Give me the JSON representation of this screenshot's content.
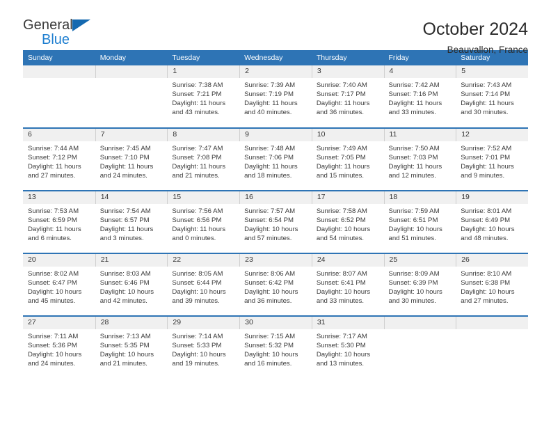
{
  "brand": {
    "name_part1": "General",
    "name_part2": "Blue",
    "accent_color": "#1f7fd0",
    "triangle_color": "#1569b0",
    "triangle_icon": "triangle-icon"
  },
  "header": {
    "title": "October 2024",
    "subtitle": "Beauvallon, France"
  },
  "theme": {
    "header_blue": "#2e74b5",
    "daynum_band": "#f0f0f0",
    "text": "#3a3a3a"
  },
  "weekdays": [
    "Sunday",
    "Monday",
    "Tuesday",
    "Wednesday",
    "Thursday",
    "Friday",
    "Saturday"
  ],
  "labels": {
    "sunrise_prefix": "Sunrise:",
    "sunset_prefix": "Sunset:",
    "daylight_prefix": "Daylight:"
  },
  "weeks": [
    [
      {
        "day": "",
        "empty": true
      },
      {
        "day": "",
        "empty": true
      },
      {
        "day": "1",
        "sunrise": "Sunrise: 7:38 AM",
        "sunset": "Sunset: 7:21 PM",
        "daylight": "Daylight: 11 hours and 43 minutes."
      },
      {
        "day": "2",
        "sunrise": "Sunrise: 7:39 AM",
        "sunset": "Sunset: 7:19 PM",
        "daylight": "Daylight: 11 hours and 40 minutes."
      },
      {
        "day": "3",
        "sunrise": "Sunrise: 7:40 AM",
        "sunset": "Sunset: 7:17 PM",
        "daylight": "Daylight: 11 hours and 36 minutes."
      },
      {
        "day": "4",
        "sunrise": "Sunrise: 7:42 AM",
        "sunset": "Sunset: 7:16 PM",
        "daylight": "Daylight: 11 hours and 33 minutes."
      },
      {
        "day": "5",
        "sunrise": "Sunrise: 7:43 AM",
        "sunset": "Sunset: 7:14 PM",
        "daylight": "Daylight: 11 hours and 30 minutes."
      }
    ],
    [
      {
        "day": "6",
        "sunrise": "Sunrise: 7:44 AM",
        "sunset": "Sunset: 7:12 PM",
        "daylight": "Daylight: 11 hours and 27 minutes."
      },
      {
        "day": "7",
        "sunrise": "Sunrise: 7:45 AM",
        "sunset": "Sunset: 7:10 PM",
        "daylight": "Daylight: 11 hours and 24 minutes."
      },
      {
        "day": "8",
        "sunrise": "Sunrise: 7:47 AM",
        "sunset": "Sunset: 7:08 PM",
        "daylight": "Daylight: 11 hours and 21 minutes."
      },
      {
        "day": "9",
        "sunrise": "Sunrise: 7:48 AM",
        "sunset": "Sunset: 7:06 PM",
        "daylight": "Daylight: 11 hours and 18 minutes."
      },
      {
        "day": "10",
        "sunrise": "Sunrise: 7:49 AM",
        "sunset": "Sunset: 7:05 PM",
        "daylight": "Daylight: 11 hours and 15 minutes."
      },
      {
        "day": "11",
        "sunrise": "Sunrise: 7:50 AM",
        "sunset": "Sunset: 7:03 PM",
        "daylight": "Daylight: 11 hours and 12 minutes."
      },
      {
        "day": "12",
        "sunrise": "Sunrise: 7:52 AM",
        "sunset": "Sunset: 7:01 PM",
        "daylight": "Daylight: 11 hours and 9 minutes."
      }
    ],
    [
      {
        "day": "13",
        "sunrise": "Sunrise: 7:53 AM",
        "sunset": "Sunset: 6:59 PM",
        "daylight": "Daylight: 11 hours and 6 minutes."
      },
      {
        "day": "14",
        "sunrise": "Sunrise: 7:54 AM",
        "sunset": "Sunset: 6:57 PM",
        "daylight": "Daylight: 11 hours and 3 minutes."
      },
      {
        "day": "15",
        "sunrise": "Sunrise: 7:56 AM",
        "sunset": "Sunset: 6:56 PM",
        "daylight": "Daylight: 11 hours and 0 minutes."
      },
      {
        "day": "16",
        "sunrise": "Sunrise: 7:57 AM",
        "sunset": "Sunset: 6:54 PM",
        "daylight": "Daylight: 10 hours and 57 minutes."
      },
      {
        "day": "17",
        "sunrise": "Sunrise: 7:58 AM",
        "sunset": "Sunset: 6:52 PM",
        "daylight": "Daylight: 10 hours and 54 minutes."
      },
      {
        "day": "18",
        "sunrise": "Sunrise: 7:59 AM",
        "sunset": "Sunset: 6:51 PM",
        "daylight": "Daylight: 10 hours and 51 minutes."
      },
      {
        "day": "19",
        "sunrise": "Sunrise: 8:01 AM",
        "sunset": "Sunset: 6:49 PM",
        "daylight": "Daylight: 10 hours and 48 minutes."
      }
    ],
    [
      {
        "day": "20",
        "sunrise": "Sunrise: 8:02 AM",
        "sunset": "Sunset: 6:47 PM",
        "daylight": "Daylight: 10 hours and 45 minutes."
      },
      {
        "day": "21",
        "sunrise": "Sunrise: 8:03 AM",
        "sunset": "Sunset: 6:46 PM",
        "daylight": "Daylight: 10 hours and 42 minutes."
      },
      {
        "day": "22",
        "sunrise": "Sunrise: 8:05 AM",
        "sunset": "Sunset: 6:44 PM",
        "daylight": "Daylight: 10 hours and 39 minutes."
      },
      {
        "day": "23",
        "sunrise": "Sunrise: 8:06 AM",
        "sunset": "Sunset: 6:42 PM",
        "daylight": "Daylight: 10 hours and 36 minutes."
      },
      {
        "day": "24",
        "sunrise": "Sunrise: 8:07 AM",
        "sunset": "Sunset: 6:41 PM",
        "daylight": "Daylight: 10 hours and 33 minutes."
      },
      {
        "day": "25",
        "sunrise": "Sunrise: 8:09 AM",
        "sunset": "Sunset: 6:39 PM",
        "daylight": "Daylight: 10 hours and 30 minutes."
      },
      {
        "day": "26",
        "sunrise": "Sunrise: 8:10 AM",
        "sunset": "Sunset: 6:38 PM",
        "daylight": "Daylight: 10 hours and 27 minutes."
      }
    ],
    [
      {
        "day": "27",
        "sunrise": "Sunrise: 7:11 AM",
        "sunset": "Sunset: 5:36 PM",
        "daylight": "Daylight: 10 hours and 24 minutes."
      },
      {
        "day": "28",
        "sunrise": "Sunrise: 7:13 AM",
        "sunset": "Sunset: 5:35 PM",
        "daylight": "Daylight: 10 hours and 21 minutes."
      },
      {
        "day": "29",
        "sunrise": "Sunrise: 7:14 AM",
        "sunset": "Sunset: 5:33 PM",
        "daylight": "Daylight: 10 hours and 19 minutes."
      },
      {
        "day": "30",
        "sunrise": "Sunrise: 7:15 AM",
        "sunset": "Sunset: 5:32 PM",
        "daylight": "Daylight: 10 hours and 16 minutes."
      },
      {
        "day": "31",
        "sunrise": "Sunrise: 7:17 AM",
        "sunset": "Sunset: 5:30 PM",
        "daylight": "Daylight: 10 hours and 13 minutes."
      },
      {
        "day": "",
        "empty": true
      },
      {
        "day": "",
        "empty": true
      }
    ]
  ]
}
